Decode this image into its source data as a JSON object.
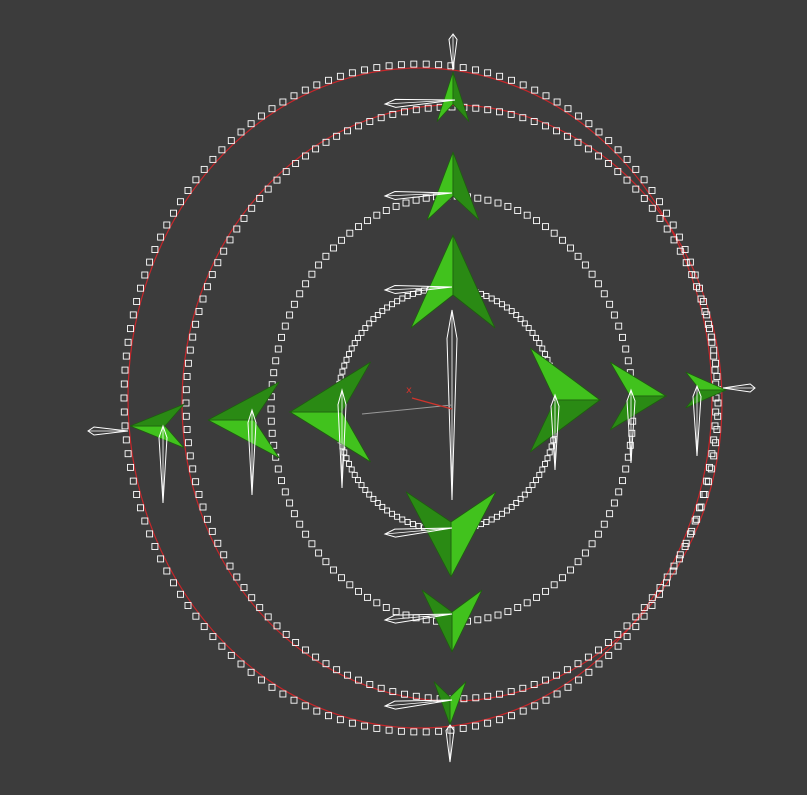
{
  "viewport": {
    "background": "#3c3c3c",
    "axis_x_label": "x",
    "axis_x_color": "#d0342c",
    "ring_color": "#ffffff",
    "spline_color": "#c8262a",
    "leaf_light": "#41c21d",
    "leaf_dark": "#2a8a14",
    "wire_color": "#ffffff"
  }
}
